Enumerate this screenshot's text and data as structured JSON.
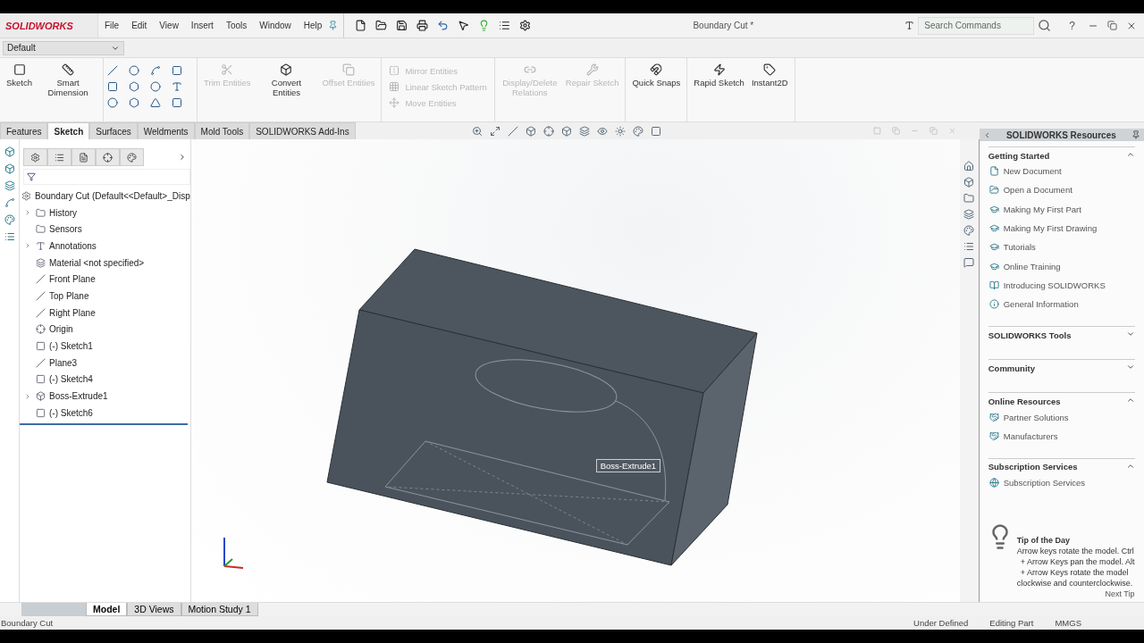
{
  "app": {
    "logo": "SOLIDWORKS",
    "menu": [
      "File",
      "Edit",
      "View",
      "Insert",
      "Tools",
      "Window",
      "Help"
    ],
    "title": "Boundary Cut *",
    "search": {
      "placeholder": "Search Commands"
    },
    "help": "?"
  },
  "configuration": {
    "value": "Default"
  },
  "command_groups": [
    {
      "kind": "large",
      "tools": [
        {
          "label": "Sketch",
          "disabled": false
        },
        {
          "label": "Smart Dimension",
          "disabled": false
        }
      ]
    },
    {
      "kind": "grid"
    },
    {
      "kind": "large",
      "tools": [
        {
          "label": "Trim Entities",
          "disabled": true
        },
        {
          "label": "Convert Entities",
          "disabled": false
        },
        {
          "label": "Offset Entities",
          "disabled": true
        }
      ]
    },
    {
      "kind": "stack",
      "tools": [
        {
          "label": "Mirror Entities",
          "disabled": true
        },
        {
          "label": "Linear Sketch Pattern",
          "disabled": true
        },
        {
          "label": "Move Entities",
          "disabled": true
        }
      ]
    },
    {
      "kind": "large",
      "tools": [
        {
          "label": "Display/Delete Relations",
          "disabled": true
        },
        {
          "label": "Repair Sketch",
          "disabled": true
        }
      ]
    },
    {
      "kind": "large",
      "tools": [
        {
          "label": "Quick Snaps",
          "disabled": false
        }
      ]
    },
    {
      "kind": "large",
      "tools": [
        {
          "label": "Rapid Sketch",
          "disabled": false
        },
        {
          "label": "Instant2D",
          "disabled": false
        }
      ]
    }
  ],
  "tabs": [
    {
      "label": "Features",
      "selected": false
    },
    {
      "label": "Sketch",
      "selected": true
    },
    {
      "label": "Surfaces",
      "selected": false
    },
    {
      "label": "Weldments",
      "selected": false
    },
    {
      "label": "Mold Tools",
      "selected": false
    },
    {
      "label": "SOLIDWORKS Add-Ins",
      "selected": false
    }
  ],
  "feature_tree": {
    "root": "Boundary Cut  (Default<<Default>_Disp",
    "items": [
      {
        "label": "History",
        "kind": "folder",
        "expandable": true
      },
      {
        "label": "Sensors",
        "kind": "folder",
        "expandable": false
      },
      {
        "label": "Annotations",
        "kind": "annotation",
        "expandable": true
      },
      {
        "label": "Material <not specified>",
        "kind": "material",
        "expandable": false
      },
      {
        "label": "Front Plane",
        "kind": "plane",
        "expandable": false
      },
      {
        "label": "Top Plane",
        "kind": "plane",
        "expandable": false
      },
      {
        "label": "Right Plane",
        "kind": "plane",
        "expandable": false
      },
      {
        "label": "Origin",
        "kind": "origin",
        "expandable": false
      },
      {
        "label": "(-) Sketch1",
        "kind": "sketch",
        "expandable": false
      },
      {
        "label": "Plane3",
        "kind": "plane",
        "expandable": false
      },
      {
        "label": "(-) Sketch4",
        "kind": "sketch",
        "expandable": false
      },
      {
        "label": "Boss-Extrude1",
        "kind": "feature",
        "expandable": true
      },
      {
        "label": "(-) Sketch6",
        "kind": "sketch",
        "expandable": false
      }
    ]
  },
  "viewport": {
    "tooltip": "Boss-Extrude1"
  },
  "task_pane": {
    "title": "SOLIDWORKS Resources",
    "sections": [
      {
        "title": "Getting Started",
        "expanded": true,
        "items": [
          {
            "label": "New Document",
            "kind": "document"
          },
          {
            "label": "Open a Document",
            "kind": "open"
          },
          {
            "label": "Making My First Part",
            "kind": "tutorial"
          },
          {
            "label": "Making My First Drawing",
            "kind": "tutorial"
          },
          {
            "label": "Tutorials",
            "kind": "tutorial"
          },
          {
            "label": "Online Training",
            "kind": "tutorial"
          },
          {
            "label": "Introducing SOLIDWORKS",
            "kind": "intro"
          },
          {
            "label": "General Information",
            "kind": "info"
          }
        ]
      },
      {
        "title": "SOLIDWORKS Tools",
        "expanded": false
      },
      {
        "title": "Community",
        "expanded": false
      },
      {
        "title": "Online Resources",
        "expanded": true,
        "items": [
          {
            "label": "Partner Solutions",
            "kind": "partner"
          },
          {
            "label": "Manufacturers",
            "kind": "partner"
          }
        ]
      },
      {
        "title": "Subscription Services",
        "expanded": true,
        "items": [
          {
            "label": "Subscription Services",
            "kind": "subscription"
          }
        ]
      }
    ],
    "tip": {
      "title": "Tip of the Day",
      "lines": [
        "Arrow keys rotate the model. Ctrl",
        "+ Arrow Keys pan the model. Alt",
        "+ Arrow Keys rotate the model",
        "clockwise and counterclockwise."
      ],
      "next": "Next Tip"
    }
  },
  "bottom_tabs": [
    {
      "label": "Model",
      "selected": true
    },
    {
      "label": "3D Views",
      "selected": false
    },
    {
      "label": "Motion Study 1",
      "selected": false
    }
  ],
  "status_bar": {
    "document": "Boundary Cut",
    "sketch_state": "Under Defined",
    "mode": "Editing Part",
    "units": "MMGS"
  }
}
